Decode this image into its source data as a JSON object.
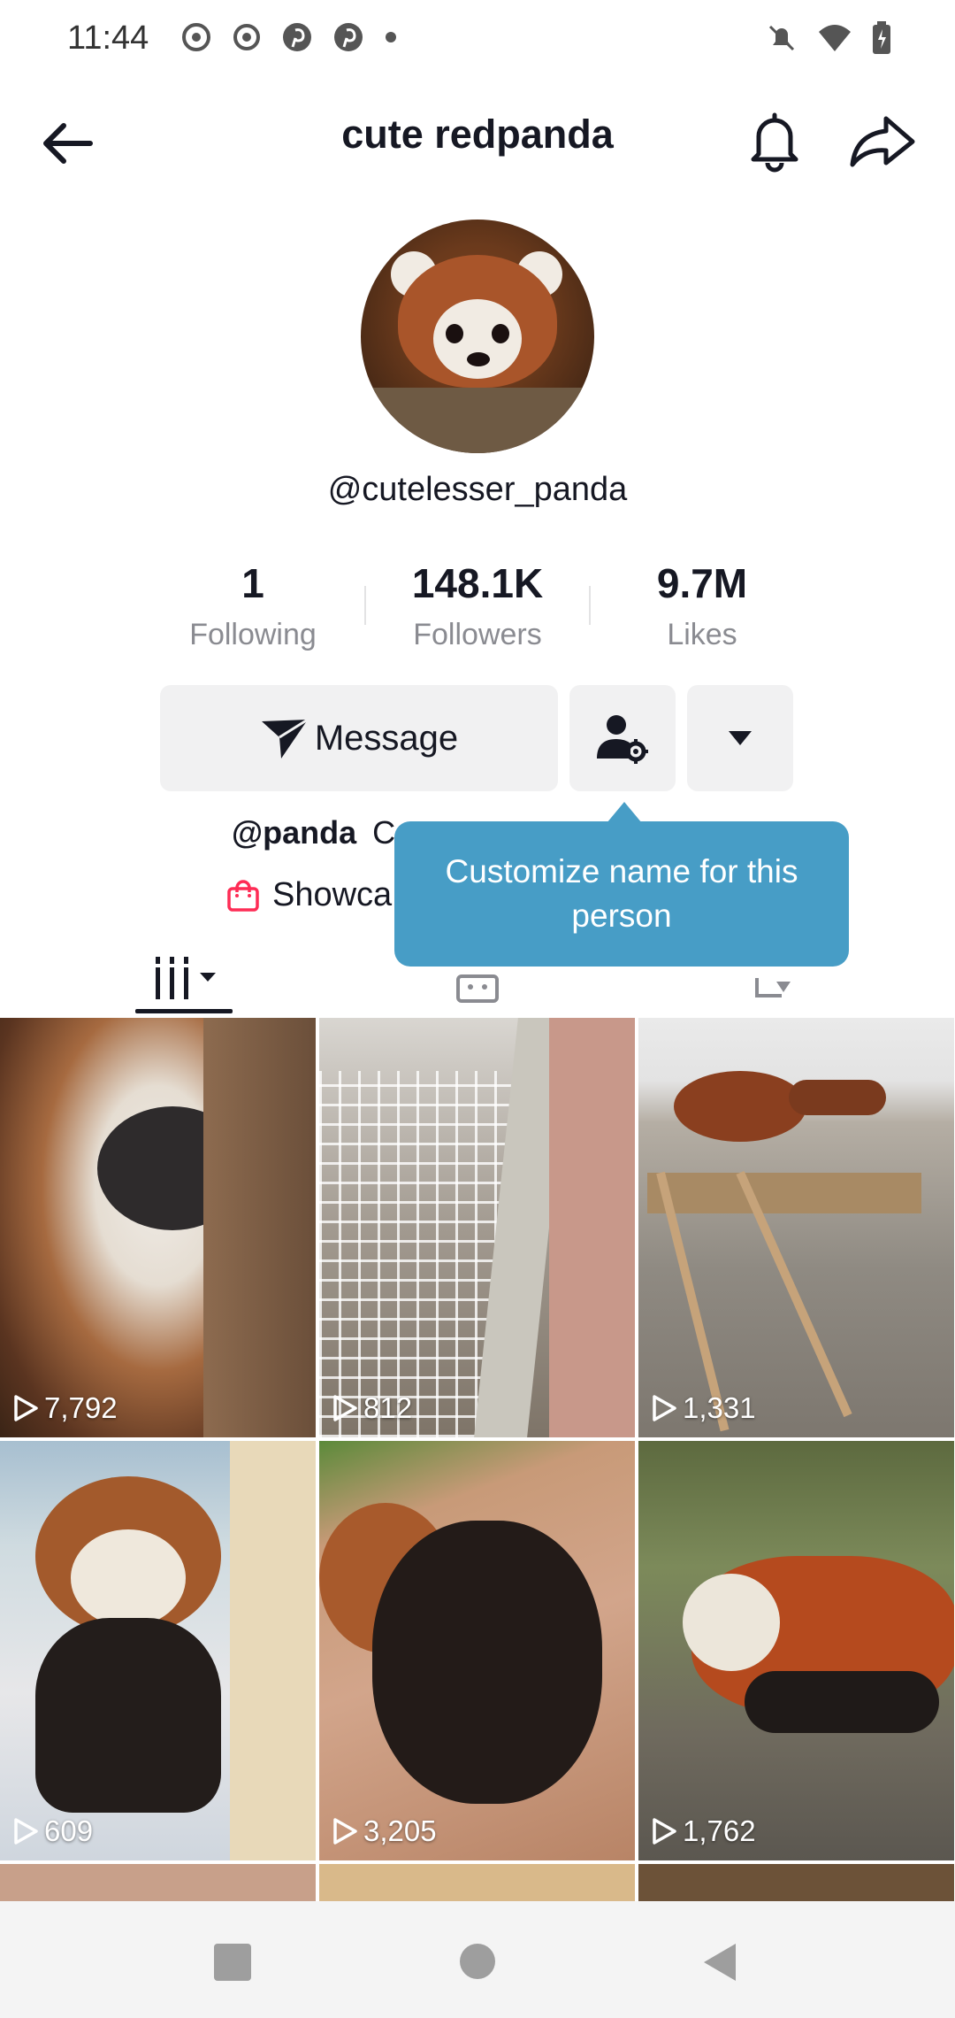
{
  "status_bar": {
    "time": "11:44"
  },
  "header": {
    "title": "cute redpanda"
  },
  "profile": {
    "username": "@cutelesser_panda"
  },
  "stats": [
    {
      "value": "1",
      "label": "Following"
    },
    {
      "value": "148.1K",
      "label": "Followers"
    },
    {
      "value": "9.7M",
      "label": "Likes"
    }
  ],
  "actions": {
    "message_label": "Message"
  },
  "bio": {
    "handle": "@panda",
    "rest": "C"
  },
  "showcase": {
    "label": "Showca"
  },
  "tooltip": {
    "text": "Customize name for this person"
  },
  "videos": [
    {
      "views": "7,792"
    },
    {
      "views": "812"
    },
    {
      "views": "1,331"
    },
    {
      "views": "609"
    },
    {
      "views": "3,205"
    },
    {
      "views": "1,762"
    }
  ],
  "colors": {
    "tooltip_bg": "#479dc6",
    "shop_icon": "#fe2c55",
    "button_bg": "#f1f1f2"
  }
}
